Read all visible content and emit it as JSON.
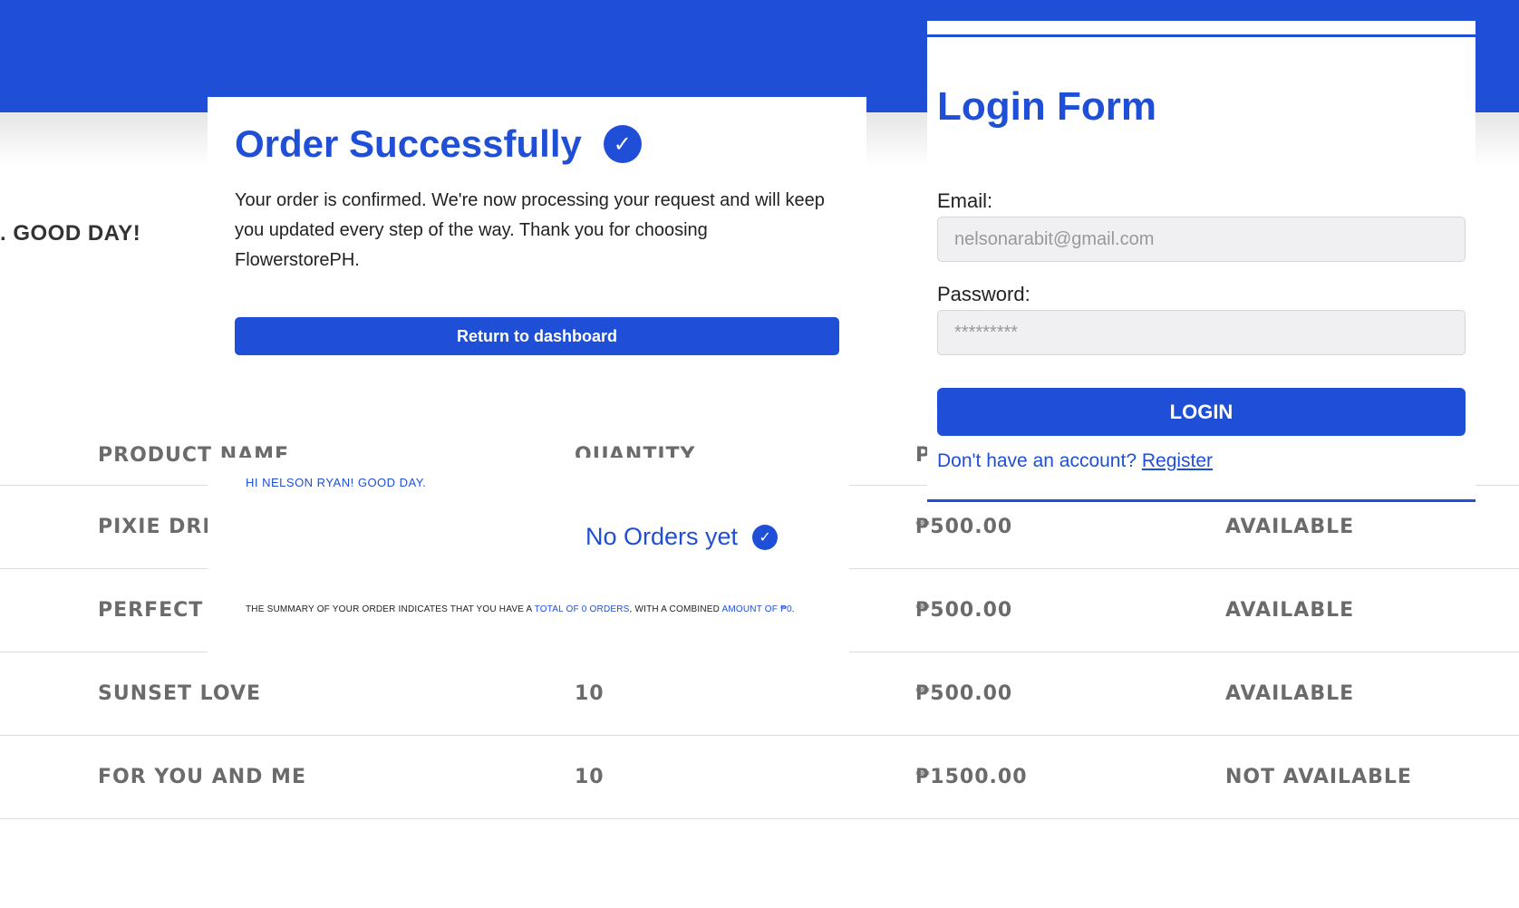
{
  "colors": {
    "brand": "#1f4fd6"
  },
  "background": {
    "greeting": ". GOOD DAY!"
  },
  "table": {
    "headers": [
      "PRODUCT NAME",
      "QUANTITY",
      "P",
      ""
    ],
    "rows": [
      [
        "PIXIE DREA",
        "",
        "₱500.00",
        "AVAILABLE"
      ],
      [
        "PERFECT YC",
        "",
        "₱500.00",
        "AVAILABLE"
      ],
      [
        "SUNSET LOVE",
        "10",
        "₱500.00",
        "AVAILABLE"
      ],
      [
        "FOR YOU AND ME",
        "10",
        "₱1500.00",
        "NOT AVAILABLE"
      ]
    ]
  },
  "order": {
    "title": "Order Successfully",
    "check_icon": "check-circle-icon",
    "message": "Your order is confirmed. We're now processing your request and will keep you updated every step of the way. Thank you for choosing FlowerstorePH.",
    "return_label": "Return to dashboard"
  },
  "summary": {
    "greeting": "HI NELSON RYAN! GOOD DAY.",
    "status": "No Orders yet",
    "line_prefix": "THE SUMMARY OF YOUR ORDER INDICATES THAT YOU HAVE A ",
    "total_orders": "TOTAL OF 0 ORDERS",
    "line_middle": ", WITH A COMBINED ",
    "amount": "AMOUNT OF ₱0",
    "line_suffix": "."
  },
  "login": {
    "title": "Login Form",
    "email_label": "Email:",
    "email_value": "nelsonarabit@gmail.com",
    "password_label": "Password:",
    "password_value": "*********",
    "button_label": "LOGIN",
    "register_prompt": "Don't have an account? ",
    "register_link": "Register"
  }
}
